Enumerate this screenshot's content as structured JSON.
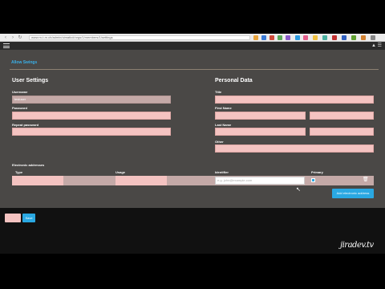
{
  "browser": {
    "url": "www.m-t-m.ch/admin/uimatic#/orgs/1/members/1/settings",
    "back_icon": "‹",
    "forward_icon": "›",
    "reload_icon": "↻"
  },
  "topbar": {
    "right_icons": "▲ ☰"
  },
  "tab": {
    "label": "Allow Swings"
  },
  "user_settings": {
    "title": "User Settings",
    "username_label": "Username",
    "username_value": "testuser",
    "password_label": "Password",
    "repeat_password_label": "Repeat password"
  },
  "personal_data": {
    "title": "Personal Data",
    "title_label": "Title",
    "first_name_label": "First Name",
    "last_name_label": "Last Name",
    "other_label": "Other"
  },
  "electronic_addresses": {
    "title": "Electronic addresses",
    "col_type": "Type",
    "col_usage": "Usage",
    "col_identifier": "Identifier",
    "col_primary": "Primary",
    "identifier_placeholder": "e.g. john@example.com",
    "delete_icon": "🗑",
    "add_button": "Add electronic address"
  },
  "footer": {
    "save_button": "Save"
  },
  "watermark": "jiradev.tv"
}
